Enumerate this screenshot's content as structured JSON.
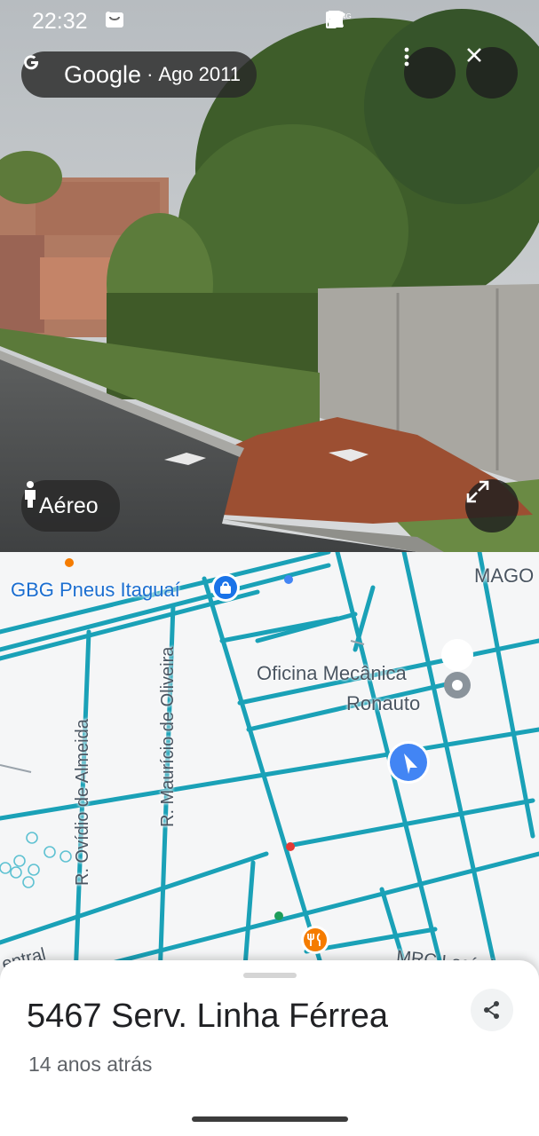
{
  "status_bar": {
    "time": "22:32",
    "network_badge": "4G"
  },
  "street_view": {
    "provider": "Google",
    "date_separator": "·",
    "capture_date": "Ago 2011",
    "mode_toggle_label": "Aéreo"
  },
  "map": {
    "labels": {
      "place_gbg": "GBG Pneus Itaguaí",
      "place_mago": "MAGO",
      "oficina_line1": "Oficina Mecânica",
      "oficina_line2": "Ronauto",
      "street_ovidio": "R. Ovídio de Almeida",
      "street_mauricio": "R. Maurício de Oliveira",
      "partial_central": "entral",
      "partial_logistica": "MRC Logística"
    },
    "colors": {
      "road": "#1aa1b7",
      "background": "#f5f6f7",
      "current_location": "#4285f4",
      "restaurant_pin": "#f57c00"
    }
  },
  "sheet": {
    "address": "5467 Serv. Linha Férrea",
    "age": "14 anos atrás"
  }
}
